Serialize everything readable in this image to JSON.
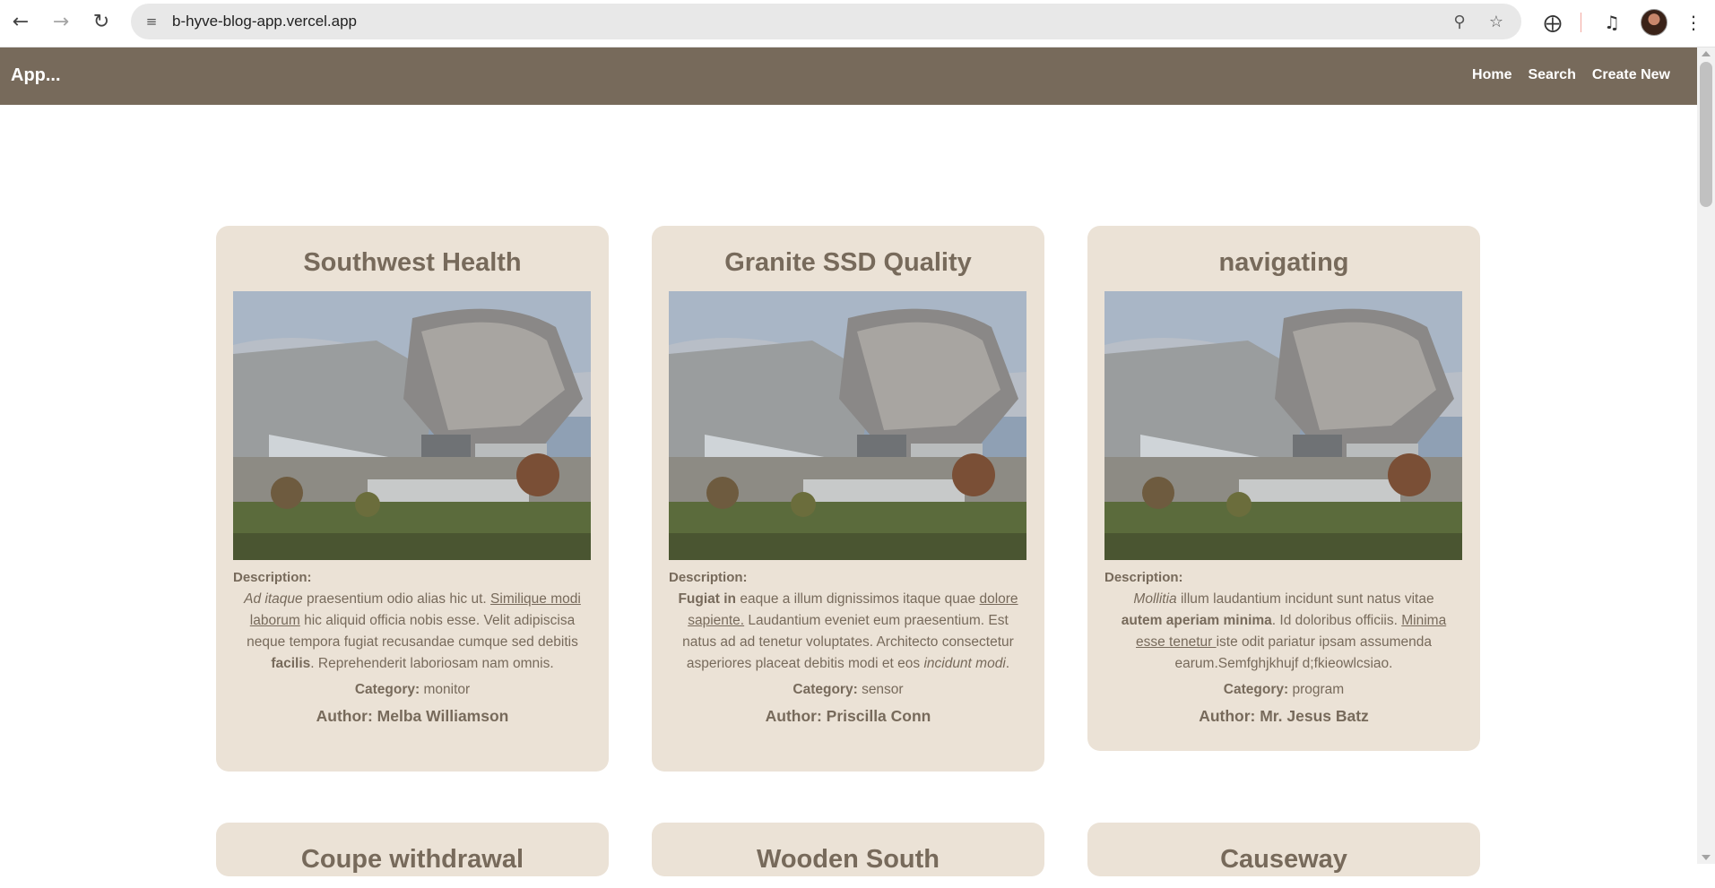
{
  "browser": {
    "url": "b-hyve-blog-app.vercel.app"
  },
  "app": {
    "brand": "App...",
    "nav": [
      {
        "label": "Home"
      },
      {
        "label": "Search"
      },
      {
        "label": "Create New"
      }
    ]
  },
  "posts": [
    {
      "title": "Southwest Health",
      "description_label": "Description:",
      "description": [
        {
          "t": "Ad itaque",
          "style": "italic"
        },
        {
          "t": " praesentium odio alias hic ut. ",
          "style": "plain"
        },
        {
          "t": "Similique modi laborum",
          "style": "underline"
        },
        {
          "t": " hic aliquid officia nobis esse. Velit adipiscisa neque tempora fugiat recusandae cumque sed debitis ",
          "style": "plain"
        },
        {
          "t": "facilis",
          "style": "bold"
        },
        {
          "t": ". Reprehenderit laboriosam nam omnis.",
          "style": "plain"
        }
      ],
      "category_label": "Category:",
      "category": "monitor",
      "author": "Author: Melba Williamson"
    },
    {
      "title": "Granite SSD Quality",
      "description_label": "Description:",
      "description": [
        {
          "t": "Fugiat in",
          "style": "bold"
        },
        {
          "t": " eaque a illum dignissimos itaque quae ",
          "style": "plain"
        },
        {
          "t": "dolore sapiente.",
          "style": "underline"
        },
        {
          "t": " Laudantium eveniet eum praesentium. Est natus ad ad tenetur voluptates. Architecto consectetur asperiores placeat debitis modi et eos ",
          "style": "plain"
        },
        {
          "t": "incidunt modi",
          "style": "italic"
        },
        {
          "t": ".",
          "style": "plain"
        }
      ],
      "category_label": "Category:",
      "category": "sensor",
      "author": "Author: Priscilla Conn"
    },
    {
      "title": "navigating",
      "description_label": "Description:",
      "description": [
        {
          "t": "Mollitia",
          "style": "italic"
        },
        {
          "t": " illum laudantium incidunt sunt natus vitae ",
          "style": "plain"
        },
        {
          "t": "autem aperiam minima",
          "style": "bold"
        },
        {
          "t": ". Id doloribus officiis. ",
          "style": "plain"
        },
        {
          "t": "Minima esse tenetur ",
          "style": "underline"
        },
        {
          "t": "iste odit pariatur ipsam assumenda earum.Semfghjkhujf d;fkieowlcsiao.",
          "style": "plain"
        }
      ],
      "category_label": "Category:",
      "category": "program",
      "author": "Author: Mr. Jesus Batz"
    },
    {
      "title": "Coupe withdrawal"
    },
    {
      "title": "Wooden South"
    },
    {
      "title": "Causeway"
    }
  ]
}
